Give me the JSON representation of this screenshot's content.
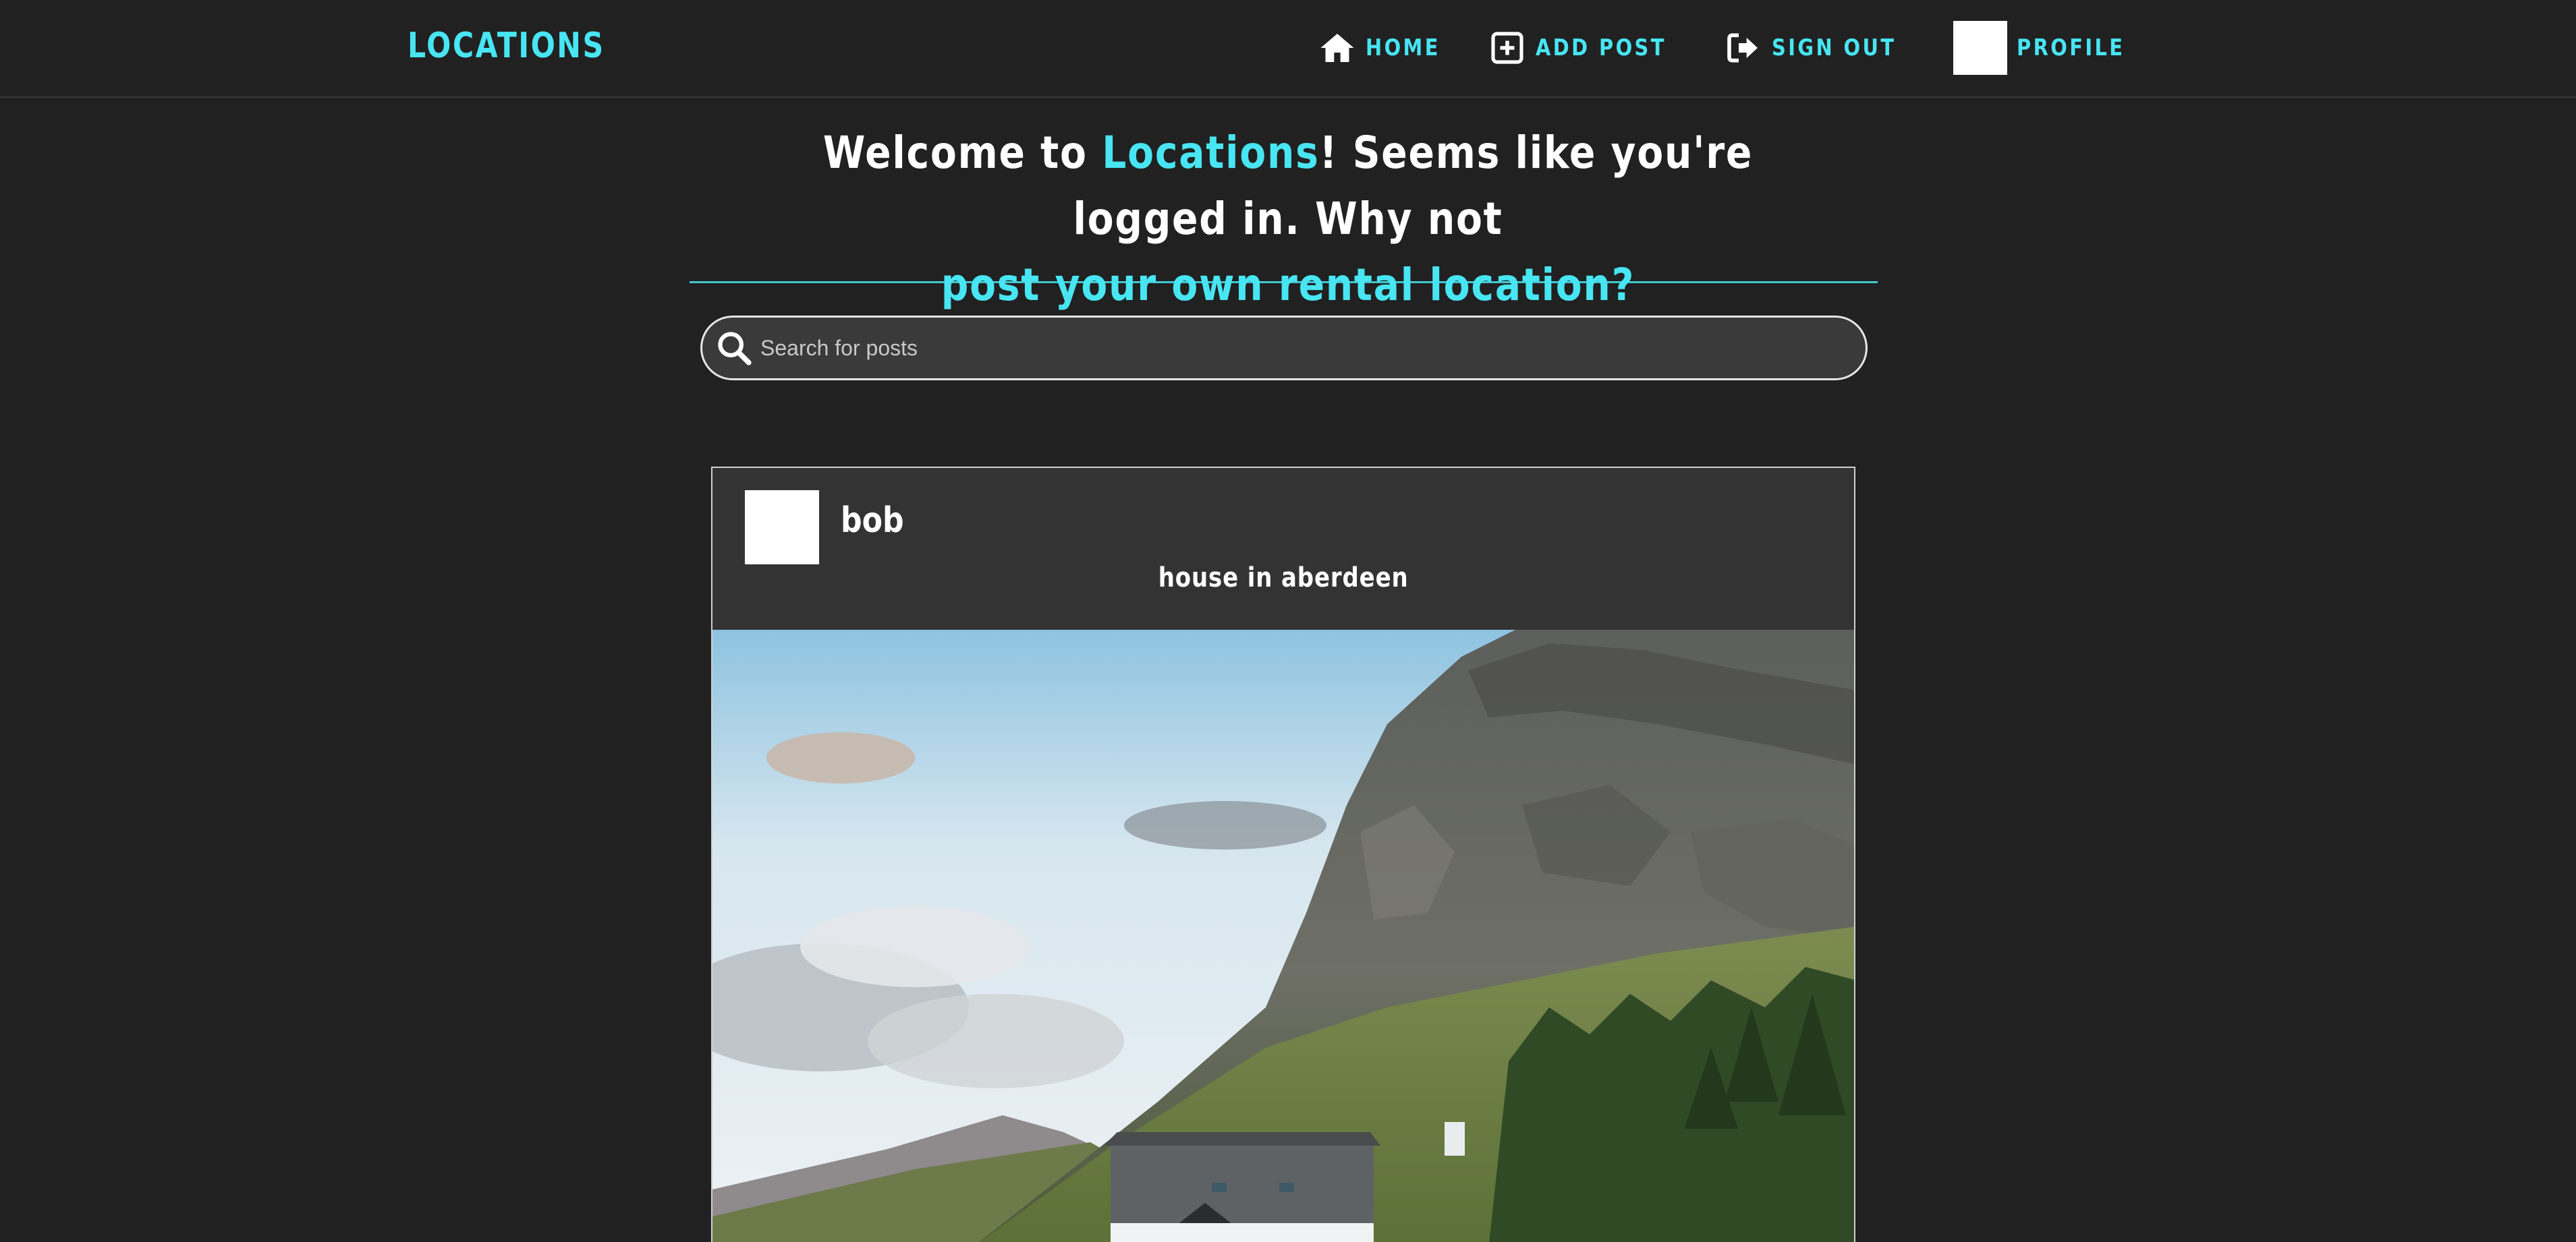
{
  "nav": {
    "brand": "LOCATIONS",
    "home": "HOME",
    "add_post": "ADD POST",
    "sign_out": "SIGN OUT",
    "profile": "PROFILE"
  },
  "welcome": {
    "part1": "Welcome to ",
    "brand": "Locations",
    "part2": "! Seems like you're logged in. Why not",
    "cta": "post your own rental location?"
  },
  "search": {
    "placeholder": "Search for posts",
    "value": ""
  },
  "posts": [
    {
      "username": "bob",
      "title": "house in aberdeen"
    }
  ],
  "colors": {
    "accent": "#48e5f2",
    "background": "#212121",
    "card": "#333333"
  },
  "icons": [
    "home-icon",
    "add-post-icon",
    "sign-out-icon",
    "search-icon"
  ]
}
